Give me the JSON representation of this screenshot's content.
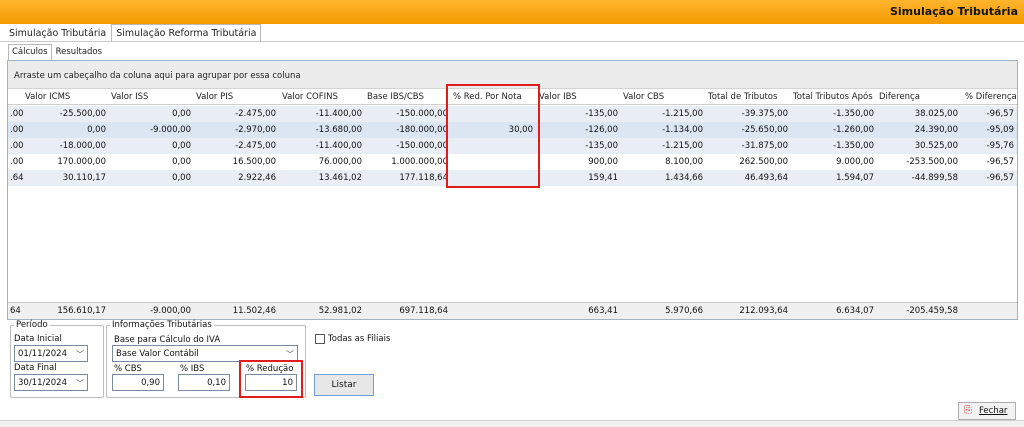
{
  "window": {
    "title": "Simulação Tributária"
  },
  "tabs": [
    {
      "label": "Simulação Tributária"
    },
    {
      "label": "Simulação Reforma Tributária"
    }
  ],
  "subtabs": [
    {
      "label": "Cálculos"
    },
    {
      "label": "Resultados"
    }
  ],
  "grid": {
    "group_hint": "Arraste um cabeçalho da coluna aqui para agrupar por essa coluna",
    "columns": [
      "Valor ICMS",
      "Valor ISS",
      "Valor PIS",
      "Valor COFINS",
      "Base IBS/CBS",
      "% Red. Por Nota",
      "Valor IBS",
      "Valor CBS",
      "Total de Tributos",
      "Total Tributos Após",
      "Diferença",
      "% Diferença"
    ],
    "rows": [
      [
        ".00",
        "-25.500,00",
        "0,00",
        "-2.475,00",
        "-11.400,00",
        "-150.000,00",
        "",
        "-135,00",
        "-1.215,00",
        "-39.375,00",
        "-1.350,00",
        "38.025,00",
        "-96,57"
      ],
      [
        ".00",
        "0,00",
        "-9.000,00",
        "-2.970,00",
        "-13.680,00",
        "-180.000,00",
        "30,00",
        "-126,00",
        "-1.134,00",
        "-25.650,00",
        "-1.260,00",
        "24.390,00",
        "-95,09"
      ],
      [
        ".00",
        "-18.000,00",
        "0,00",
        "-2.475,00",
        "-11.400,00",
        "-150.000,00",
        "",
        "-135,00",
        "-1.215,00",
        "-31.875,00",
        "-1.350,00",
        "30.525,00",
        "-95,76"
      ],
      [
        ".00",
        "170.000,00",
        "0,00",
        "16.500,00",
        "76.000,00",
        "1.000.000,00",
        "",
        "900,00",
        "8.100,00",
        "262.500,00",
        "9.000,00",
        "-253.500,00",
        "-96,57"
      ],
      [
        ".64",
        "30.110,17",
        "0,00",
        "2.922,46",
        "13.461,02",
        "177.118,64",
        "",
        "159,41",
        "1.434,66",
        "46.493,64",
        "1.594,07",
        "-44.899,58",
        "-96,57"
      ]
    ],
    "totals": [
      "64",
      "156.610,17",
      "-9.000,00",
      "11.502,46",
      "52.981,02",
      "697.118,64",
      "",
      "663,41",
      "5.970,66",
      "212.093,64",
      "6.634,07",
      "-205.459,58",
      ""
    ]
  },
  "periodo": {
    "legend": "Período",
    "data_inicial_label": "Data Inicial",
    "data_inicial": "01/11/2024",
    "data_final_label": "Data Final",
    "data_final": "30/11/2024"
  },
  "info": {
    "legend": "Informações Tributárias",
    "base_label": "Base para Cálculo do IVA",
    "base_value": "Base Valor Contábil",
    "cbs_label": "% CBS",
    "cbs_value": "0,90",
    "ibs_label": "% IBS",
    "ibs_value": "0,10",
    "reducao_label": "% Redução",
    "reducao_value": "10"
  },
  "filiais_label": "Todas as Filiais",
  "listar_label": "Listar",
  "fechar_label": "Fechar",
  "colors": {
    "titlebar": "#f49a00",
    "highlight": "#e01d1d",
    "row_alt": "#e9eef5"
  }
}
